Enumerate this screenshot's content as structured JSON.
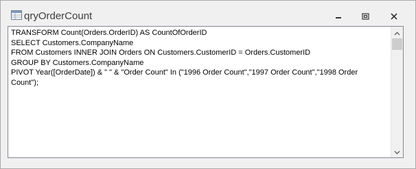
{
  "window": {
    "title": "qryOrderCount"
  },
  "editor": {
    "sql": "TRANSFORM Count(Orders.OrderID) AS CountOfOrderID\nSELECT Customers.CompanyName\nFROM Customers INNER JOIN Orders ON Customers.CustomerID = Orders.CustomerID\nGROUP BY Customers.CompanyName\nPIVOT Year([OrderDate]) & \" \" & \"Order Count\" In (\"1996 Order Count\",\"1997 Order Count\",\"1998 Order Count\");"
  },
  "icons": {
    "app": "query-datasheet-icon",
    "minimize": "minimize-icon",
    "restore": "restore-icon",
    "close": "close-icon",
    "scroll_up": "chevron-up-icon",
    "scroll_down": "chevron-down-icon"
  },
  "colors": {
    "title_text": "#3c3c3c",
    "window_bg": "#f0f0f0",
    "editor_bg": "#ffffff",
    "scroll_thumb": "#cdcdcd"
  }
}
